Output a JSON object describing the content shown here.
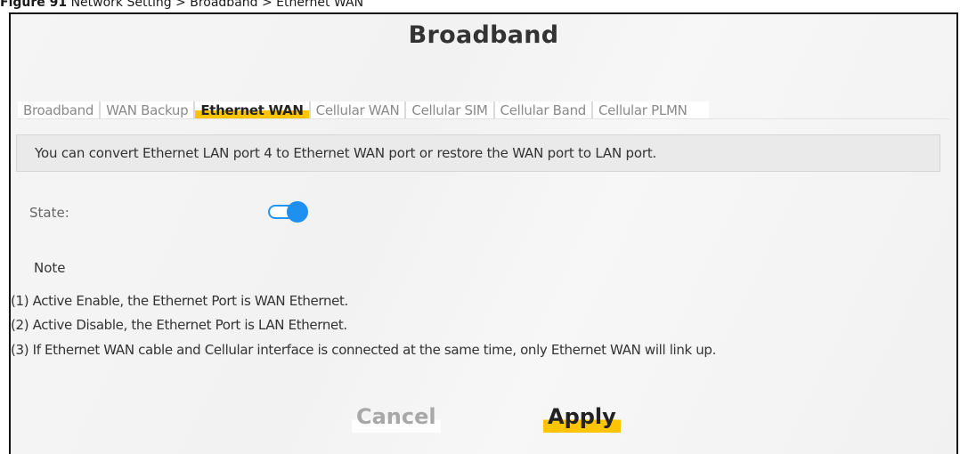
{
  "caption": {
    "figure": "Figure 91",
    "path": "Network Setting > Broadband > Ethernet WAN"
  },
  "page": {
    "title": "Broadband"
  },
  "tabs": [
    {
      "label": "Broadband",
      "active": false
    },
    {
      "label": "WAN Backup",
      "active": false
    },
    {
      "label": "Ethernet WAN",
      "active": true
    },
    {
      "label": "Cellular WAN",
      "active": false
    },
    {
      "label": "Cellular SIM",
      "active": false
    },
    {
      "label": "Cellular Band",
      "active": false
    },
    {
      "label": "Cellular PLMN",
      "active": false
    }
  ],
  "info": {
    "text": "You can convert Ethernet LAN port 4 to Ethernet WAN port or restore the WAN port to LAN port."
  },
  "state": {
    "label": "State:",
    "enabled": true
  },
  "note": {
    "title": "Note",
    "lines": [
      "(1) Active Enable, the Ethernet Port is WAN Ethernet.",
      "(2) Active Disable, the Ethernet Port is LAN Ethernet.",
      "(3) If Ethernet WAN cable and Cellular interface is connected at the same time, only Ethernet WAN will link up."
    ]
  },
  "buttons": {
    "cancel": "Cancel",
    "apply": "Apply"
  },
  "colors": {
    "accent": "#ffc400",
    "toggle_on": "#1e90f0"
  },
  "icons": {
    "state_toggle": "toggle-switch-on-icon"
  }
}
